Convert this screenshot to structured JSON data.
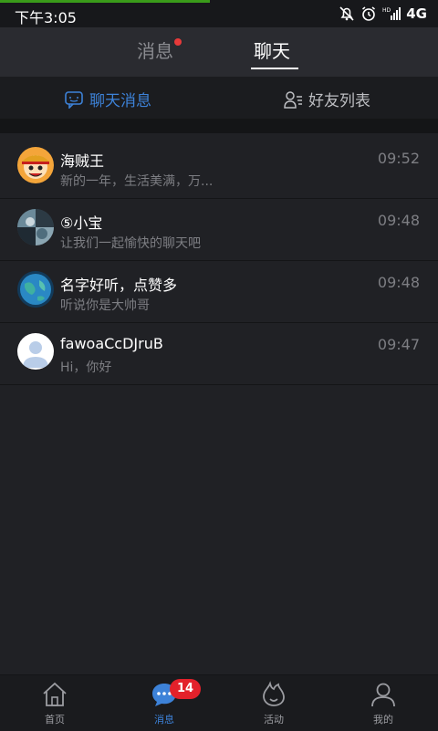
{
  "status_bar": {
    "time": "下午3:05",
    "network": "4G",
    "hd": "HD"
  },
  "top_tabs": [
    {
      "label": "消息",
      "active": false,
      "has_dot": true
    },
    {
      "label": "聊天",
      "active": true
    }
  ],
  "sub_tabs": [
    {
      "label": "聊天消息",
      "icon": "chat-message-icon",
      "active": true
    },
    {
      "label": "好友列表",
      "icon": "friend-list-icon",
      "active": false
    }
  ],
  "chats": [
    {
      "name": "海贼王",
      "preview": "新的一年，生活美满，万...",
      "time": "09:52",
      "avatar": "cartoon-avatar"
    },
    {
      "name": "⑤小宝",
      "preview": "让我们一起愉快的聊天吧",
      "time": "09:48",
      "avatar": "photo-avatar"
    },
    {
      "name": "名字好听，点赞多",
      "preview": "听说你是大帅哥",
      "time": "09:48",
      "avatar": "globe-avatar"
    },
    {
      "name": "fawoaCcDJruB",
      "preview": "Hi，你好",
      "time": "09:47",
      "avatar": "default-avatar"
    }
  ],
  "bottom_nav": [
    {
      "label": "首页",
      "icon": "home-icon",
      "active": false
    },
    {
      "label": "消息",
      "icon": "message-icon",
      "active": true,
      "badge": "14"
    },
    {
      "label": "活动",
      "icon": "activity-icon",
      "active": false
    },
    {
      "label": "我的",
      "icon": "profile-icon",
      "active": false
    }
  ],
  "colors": {
    "accent": "#3d82d8",
    "background": "#202125",
    "badge": "#e3212b",
    "progress": "#3a9b1a"
  }
}
